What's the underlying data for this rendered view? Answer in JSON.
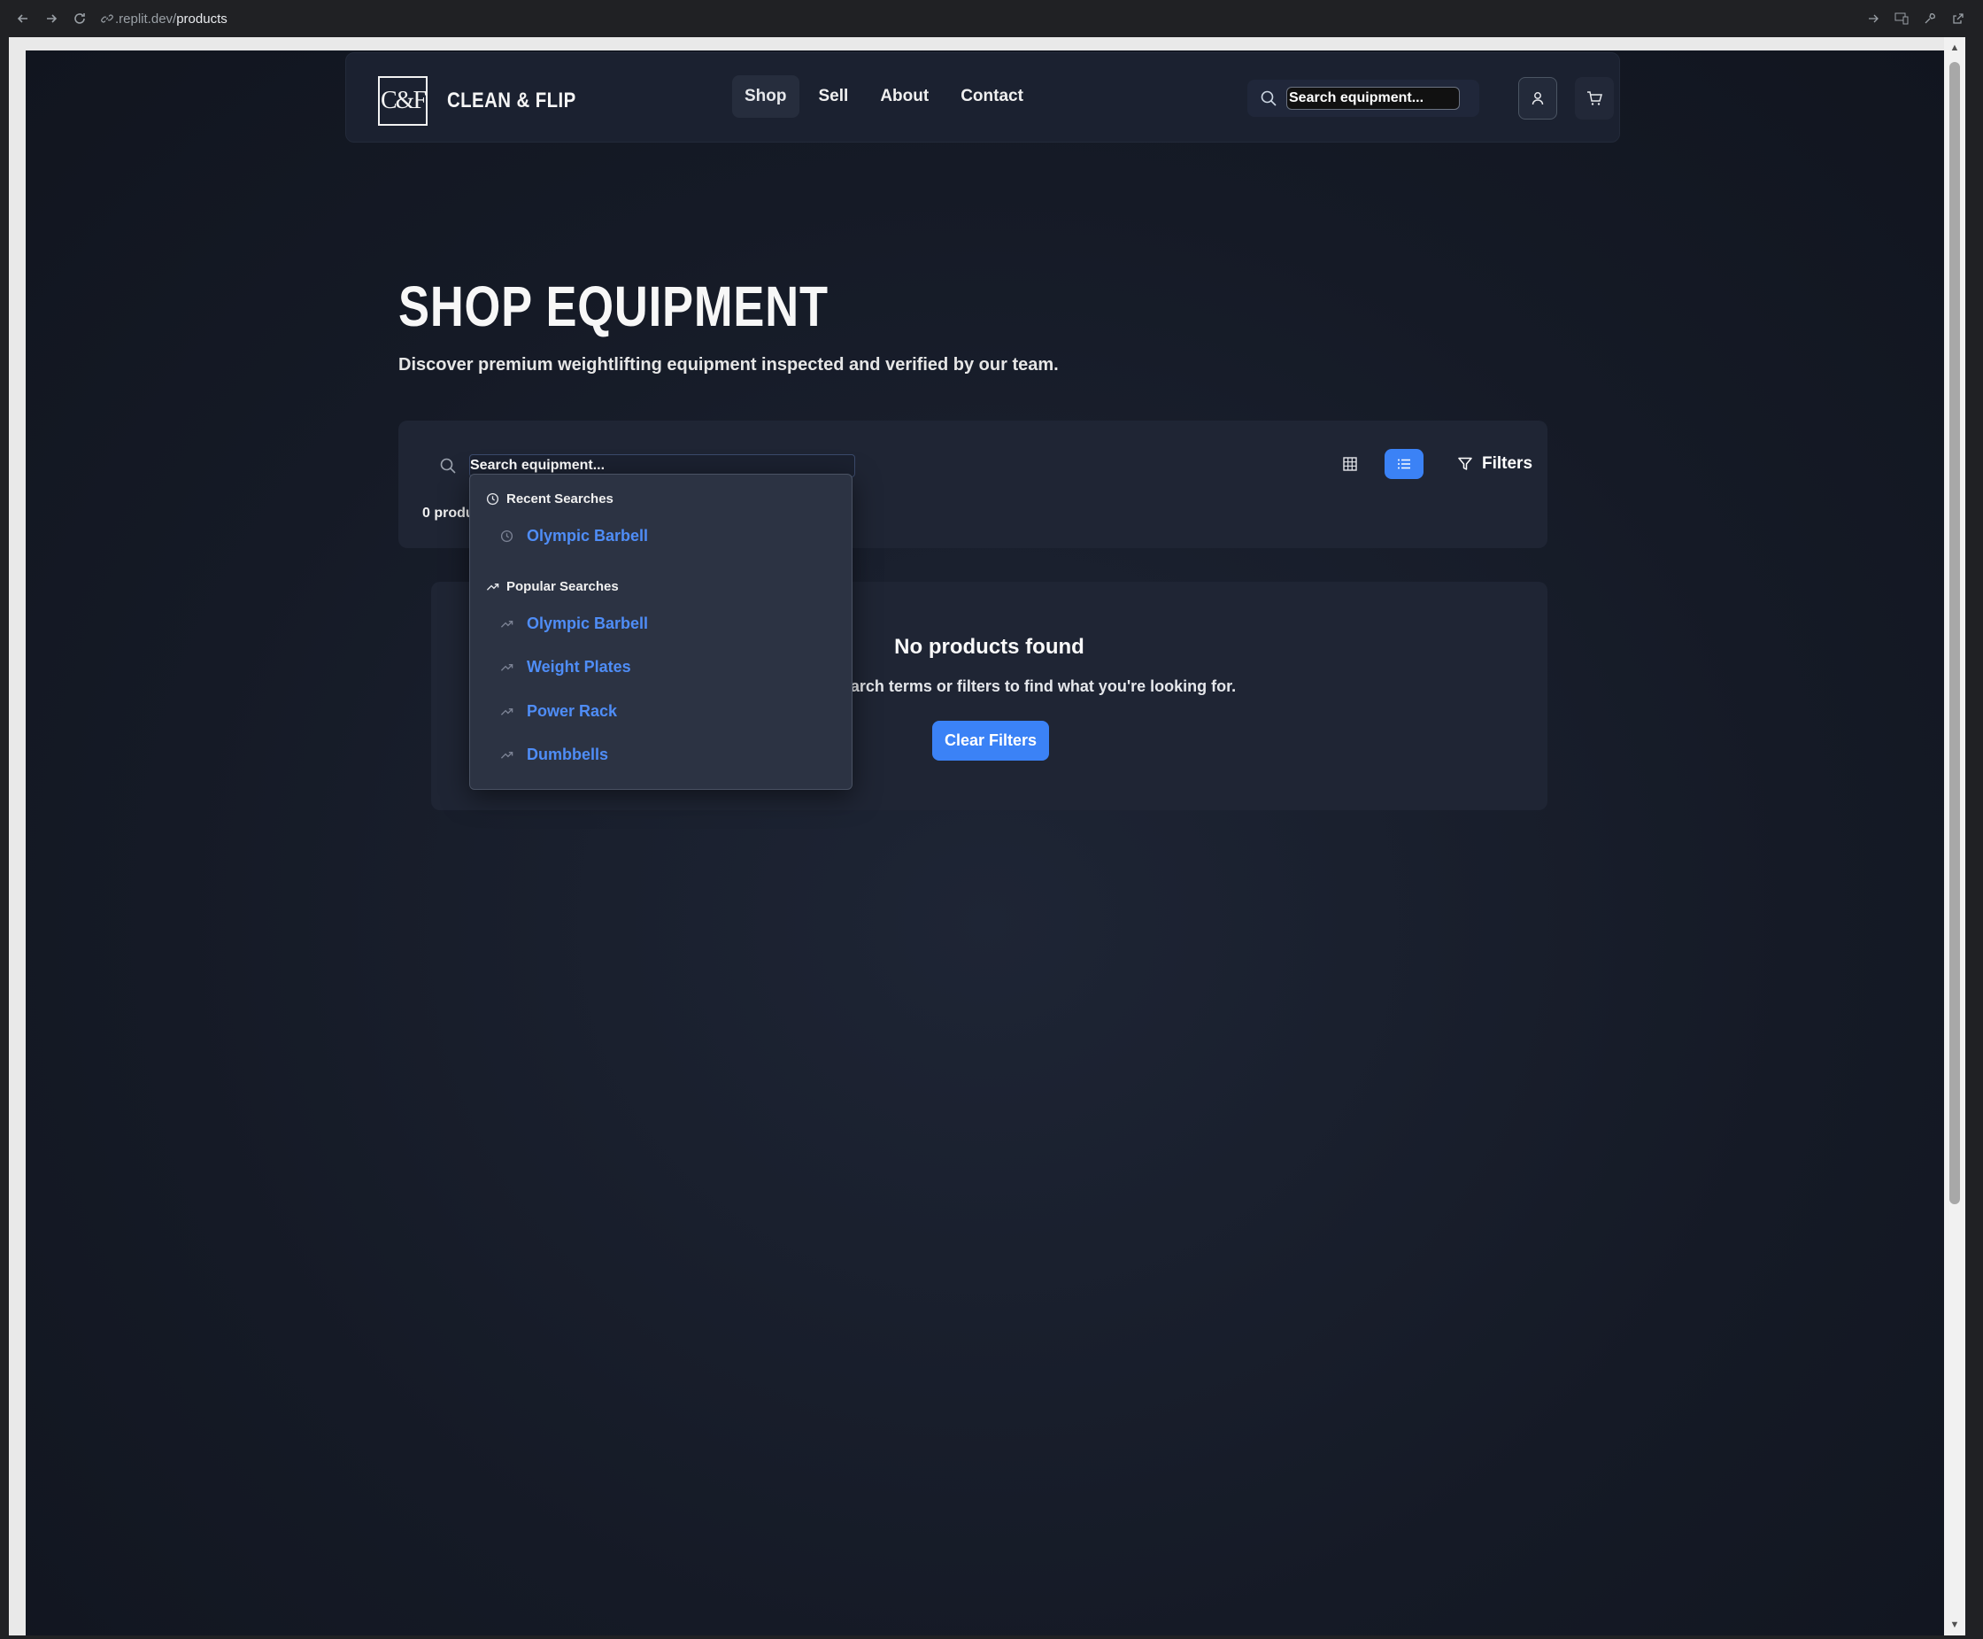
{
  "browser": {
    "url_prefix": ".replit.dev/",
    "url_path": "products"
  },
  "header": {
    "logo_mark": "C&F",
    "brand": "CLEAN & FLIP",
    "nav": [
      {
        "label": "Shop",
        "active": true
      },
      {
        "label": "Sell",
        "active": false
      },
      {
        "label": "About",
        "active": false
      },
      {
        "label": "Contact",
        "active": false
      }
    ],
    "search_value": "Search equipment..."
  },
  "page": {
    "title": "SHOP EQUIPMENT",
    "subtitle": "Discover premium weightlifting equipment inspected and verified by our team.",
    "search_value": "Search equipment...",
    "result_count": "0 produ",
    "filters_label": "Filters",
    "view_mode": "list"
  },
  "empty_state": {
    "title": "No products found",
    "text": "r search terms or filters to find what you're looking for.",
    "clear_label": "Clear Filters"
  },
  "dropdown": {
    "recent_heading": "Recent Searches",
    "recent": [
      "Olympic Barbell"
    ],
    "popular_heading": "Popular Searches",
    "popular": [
      "Olympic Barbell",
      "Weight Plates",
      "Power Rack",
      "Dumbbells"
    ]
  },
  "colors": {
    "accent": "#3b82f6",
    "link": "#4f8df7",
    "background": "#151a26",
    "card": "#1f2534"
  }
}
